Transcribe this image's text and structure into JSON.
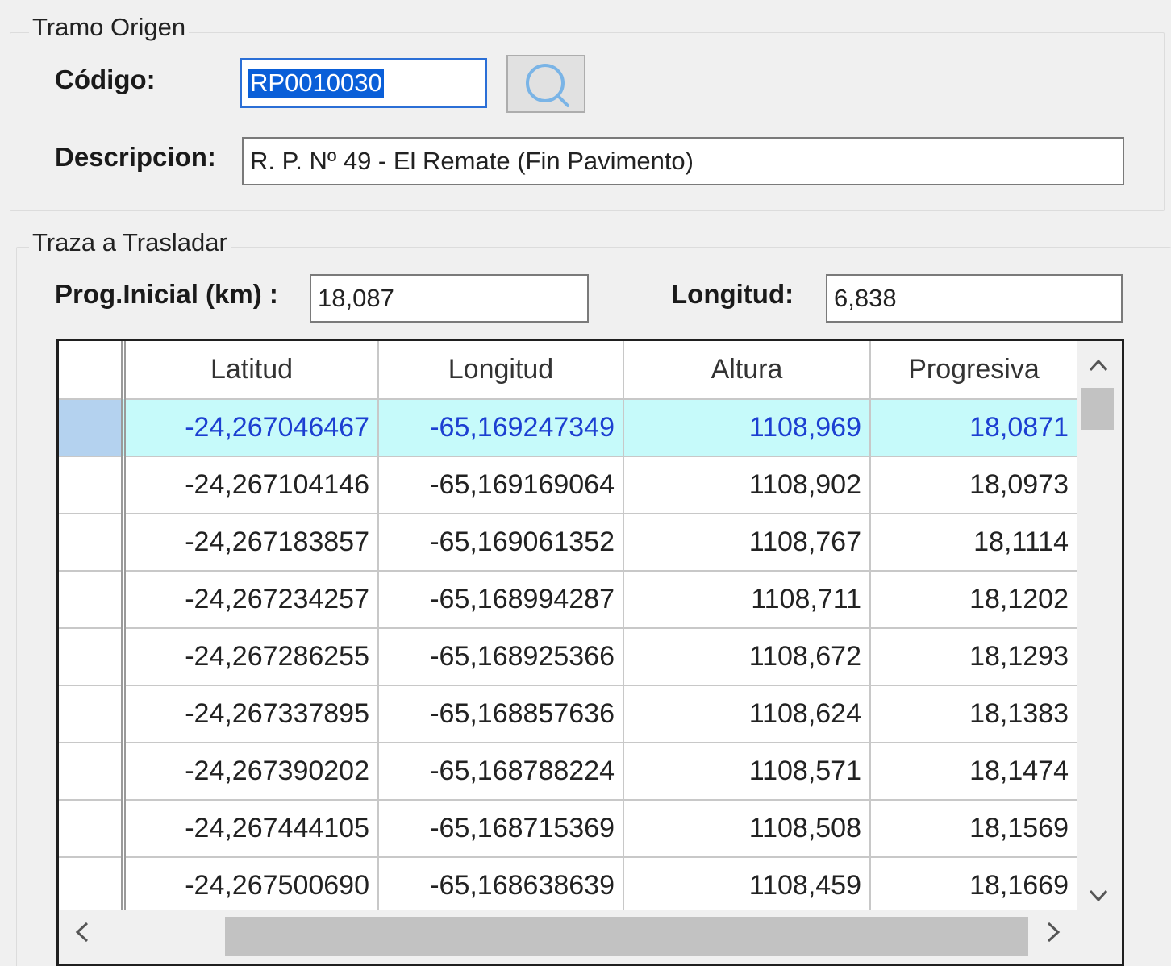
{
  "origen": {
    "title": "Tramo Origen",
    "codigo_label": "Código:",
    "codigo_value": "RP0010030",
    "descripcion_label": "Descripcion:",
    "descripcion_value": "R. P. Nº 49 - El Remate (Fin Pavimento)"
  },
  "traza": {
    "title": "Traza a Trasladar",
    "prog_label": "Prog.Inicial (km) :",
    "prog_value": "18,087",
    "longitud_label": "Longitud:",
    "longitud_value": "6,838"
  },
  "grid": {
    "columns": [
      "Latitud",
      "Longitud",
      "Altura",
      "Progresiva"
    ],
    "rows": [
      [
        "-24,267046467",
        "-65,169247349",
        "1108,969",
        "18,0871"
      ],
      [
        "-24,267104146",
        "-65,169169064",
        "1108,902",
        "18,0973"
      ],
      [
        "-24,267183857",
        "-65,169061352",
        "1108,767",
        "18,1114"
      ],
      [
        "-24,267234257",
        "-65,168994287",
        "1108,711",
        "18,1202"
      ],
      [
        "-24,267286255",
        "-65,168925366",
        "1108,672",
        "18,1293"
      ],
      [
        "-24,267337895",
        "-65,168857636",
        "1108,624",
        "18,1383"
      ],
      [
        "-24,267390202",
        "-65,168788224",
        "1108,571",
        "18,1474"
      ],
      [
        "-24,267444105",
        "-65,168715369",
        "1108,508",
        "18,1569"
      ],
      [
        "-24,267500690",
        "-65,168638639",
        "1108,459",
        "18,1669"
      ]
    ],
    "selected_row": 0
  },
  "icons": {
    "search": "search-icon",
    "scroll_up": "chevron-up-icon",
    "scroll_down": "chevron-down-icon",
    "scroll_left": "chevron-left-icon",
    "scroll_right": "chevron-right-icon"
  },
  "colors": {
    "selection_row": "#c6fafa",
    "selection_text": "#1c3fd1",
    "text_selection_bg": "#0a5fd8"
  }
}
